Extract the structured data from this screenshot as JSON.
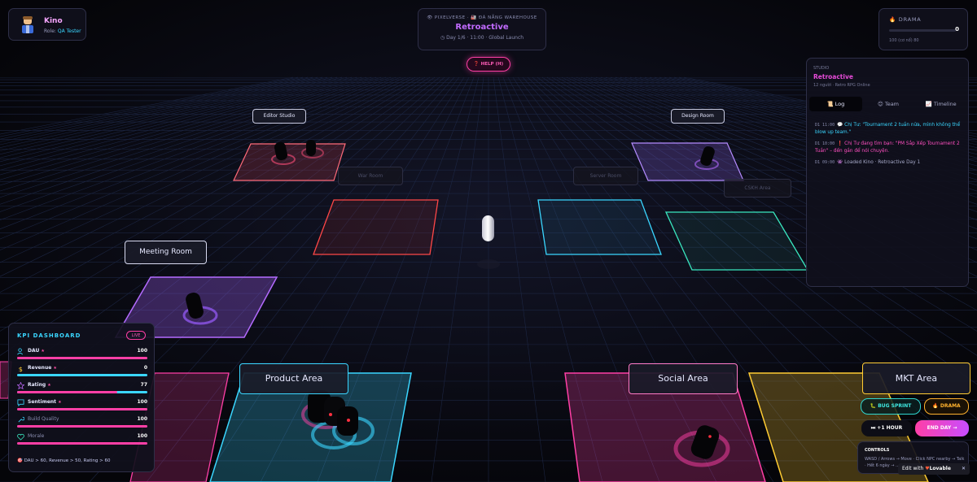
{
  "user": {
    "name": "Kino",
    "role_prefix": "Role:",
    "role": "QA Tester"
  },
  "header": {
    "crumb": "👁 PIXELVERSE · 🏭 ĐÀ NẴNG WAREHOUSE",
    "title": "Retroactive",
    "day": "Day 1/6 · 11:00 · Global Launch"
  },
  "help": {
    "label": "❓ HELP (H)"
  },
  "drama": {
    "label": "🔥 DRAMA",
    "value": "0",
    "caption": "100 (cơ nổ) 80",
    "level": 0
  },
  "studio": {
    "label": "STUDIO",
    "name": "Retroactive",
    "sub": "12 người · Retro RPG Online",
    "tabs": [
      {
        "label": "📜 Log",
        "active": true
      },
      {
        "label": "😊 Team",
        "active": false
      },
      {
        "label": "📈 Timeline",
        "active": false
      }
    ],
    "log": [
      {
        "time": "D1 11:00",
        "text": "💬 Chị Tư: \"Tournament 2 tuần nữa, mình không thể blow up team.\"",
        "color": "#3ad6ff"
      },
      {
        "time": "D1 10:00",
        "text": "❗ Chị Tư đang tìm bạn: \"PM Sắp Xếp Tournament 2 Tuần\" – đến gần để nói chuyện.",
        "color": "#ff4fc0"
      },
      {
        "time": "D1 09:00",
        "text": "👾 Loaded Kino · Retroactive Day 1",
        "color": "#a6a9c8"
      }
    ]
  },
  "kpi": {
    "title": "KPI DASHBOARD",
    "live": "LIVE",
    "rows": [
      {
        "name": "DAU",
        "star": "★",
        "value": "100",
        "fill": 1.0,
        "color": "#ff3fa6",
        "icon": "users-icon",
        "dim": false
      },
      {
        "name": "Revenue",
        "star": "★",
        "value": "0",
        "fill": 1.0,
        "color": "#3ad6ff",
        "icon": "dollar-icon",
        "dim": false
      },
      {
        "name": "Rating",
        "star": "★",
        "value": "77",
        "fill": 0.77,
        "color": "#ff3fa6",
        "icon": "star-icon",
        "dim": false
      },
      {
        "name": "Sentiment",
        "star": "★",
        "value": "100",
        "fill": 1.0,
        "color": "#ff3fa6",
        "icon": "chat-icon",
        "dim": false
      },
      {
        "name": "Build Quality",
        "star": "",
        "value": "100",
        "fill": 1.0,
        "color": "#ff3fa6",
        "icon": "wrench-icon",
        "dim": true
      },
      {
        "name": "Morale",
        "star": "",
        "value": "100",
        "fill": 1.0,
        "color": "#ff3fa6",
        "icon": "heart-icon",
        "dim": true
      }
    ],
    "goal": "🎯 DAU > 60, Revenue > 50, Rating > 60"
  },
  "actions": {
    "bug": "🐛 BUG SPRINT",
    "drama": "🔥 DRAMA",
    "hour": "⏭ +1 HOUR",
    "end": "END DAY →"
  },
  "controls": {
    "title": "CONTROLS",
    "body": "WASD / Arrows → Move · Click NPC nearby → Talk · Hết 6 ngày → ..."
  },
  "lovable": {
    "prefix": "Edit with",
    "brand": "Lovable",
    "close": "✕"
  },
  "rooms": {
    "editor": "Editor Studio",
    "design": "Design Room",
    "war": "War Room",
    "server": "Server Room",
    "cskh": "CSKH Area",
    "meeting": "Meeting Room",
    "product": "Product Area",
    "social": "Social Area",
    "mkt": "MKT Area"
  },
  "colors": {
    "bg": "#07070d",
    "grid": "#1f2a4a",
    "pink": "#ff3fa6",
    "cyan": "#3ad6ff",
    "purple": "#b46bff",
    "red": "#ff4747",
    "teal": "#3ae8c0",
    "yellow": "#ffcc33"
  }
}
